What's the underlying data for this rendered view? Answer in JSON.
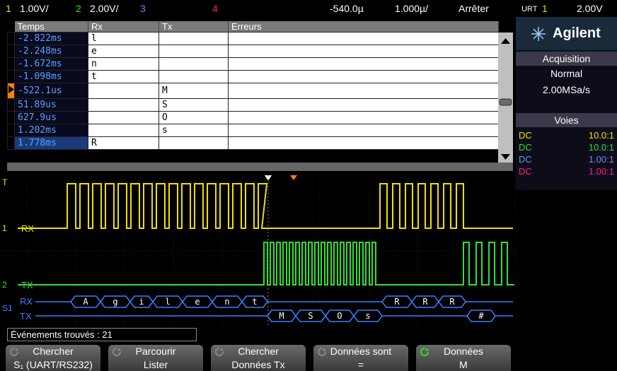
{
  "topbar": {
    "ch1_num": "1",
    "ch1_scale": "1.00V/",
    "ch2_num": "2",
    "ch2_scale": "2.00V/",
    "ch3_num": "3",
    "ch4_num": "4",
    "time_offset": "-540.0µ",
    "time_scale": "1.000µ/",
    "run_state": "Arrêter",
    "trigger_source": "URT",
    "trigger_ch": "1",
    "trigger_level": "2.00V"
  },
  "listing": {
    "headers": [
      "Temps",
      "Rx",
      "Tx",
      "Erreurs"
    ],
    "rows": [
      {
        "time": "-2.822ms",
        "rx": "l",
        "tx": "",
        "err": ""
      },
      {
        "time": "-2.248ms",
        "rx": "e",
        "tx": "",
        "err": ""
      },
      {
        "time": "-1.672ms",
        "rx": "n",
        "tx": "",
        "err": ""
      },
      {
        "time": "-1.098ms",
        "rx": "t",
        "tx": "",
        "err": ""
      },
      {
        "time": "-522.1us",
        "rx": "",
        "tx": "M",
        "err": ""
      },
      {
        "time": "51.89us",
        "rx": "",
        "tx": "S",
        "err": ""
      },
      {
        "time": "627.9us",
        "rx": "",
        "tx": "O",
        "err": ""
      },
      {
        "time": "1.202ms",
        "rx": "",
        "tx": "s",
        "err": ""
      },
      {
        "time": "1.778ms",
        "rx": "R",
        "tx": "",
        "err": ""
      }
    ]
  },
  "panel": {
    "brand": "Agilent",
    "acq_header": "Acquisition",
    "acq_mode": "Normal",
    "acq_rate": "2.00MSa/s",
    "channels_header": "Voies",
    "channels": [
      {
        "coupling": "DC",
        "probe": "10.0:1",
        "color": "#f0e000"
      },
      {
        "coupling": "DC",
        "probe": "10.0:1",
        "color": "#30e030"
      },
      {
        "coupling": "DC",
        "probe": "1.00:1",
        "color": "#6a8cff"
      },
      {
        "coupling": "DC",
        "probe": "1.00:1",
        "color": "#ff1a8c"
      }
    ]
  },
  "scope": {
    "rx_label": "RX",
    "tx_label": "TX",
    "bus_rx_label": "RX",
    "bus_tx_label": "TX",
    "rx_bytes": [
      "A",
      "g",
      "i",
      "l",
      "e",
      "n",
      "t",
      "R",
      "R",
      "R"
    ],
    "tx_bytes": [
      "M",
      "S",
      "O",
      "s",
      "#"
    ],
    "trigger_marker": "T",
    "ch1_marker": "1",
    "ch2_marker": "2",
    "serial_marker": "S1"
  },
  "events_found": "Événements trouvés : 21",
  "softkeys": [
    {
      "line1": "Chercher",
      "line2": "S₁ (UART/RS232)"
    },
    {
      "line1": "Parcourir",
      "line2": "Lister"
    },
    {
      "line1": "Chercher",
      "line2": "Données Tx"
    },
    {
      "line1": "Données sont",
      "line2": "="
    },
    {
      "line1": "Données",
      "line2": "M"
    }
  ],
  "colors": {
    "ch1": "#f0e000",
    "ch2": "#30e030",
    "bus": "#3a7fff",
    "trigger": "#ff8000"
  }
}
